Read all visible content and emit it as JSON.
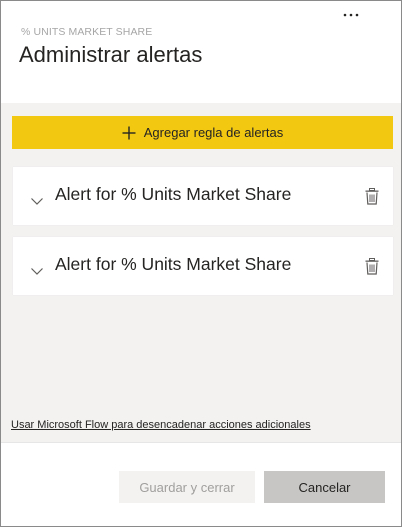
{
  "header": {
    "subtitle": "% UNITS MARKET SHARE",
    "title": "Administrar alertas",
    "more_icon": "more-horizontal-icon"
  },
  "add_rule": {
    "label": "Agregar regla de alertas",
    "icon": "plus-icon"
  },
  "rules": [
    {
      "label": "Alert for % Units Market Share",
      "expand_icon": "chevron-down-icon",
      "delete_icon": "trash-icon"
    },
    {
      "label": "Alert for % Units Market Share",
      "expand_icon": "chevron-down-icon",
      "delete_icon": "trash-icon"
    }
  ],
  "flow_link": "Usar Microsoft Flow para desencadenar acciones adicionales",
  "footer": {
    "save_label": "Guardar y cerrar",
    "cancel_label": "Cancelar"
  },
  "colors": {
    "accent": "#f2c811",
    "body_bg": "#f3f2f1",
    "cancel_bg": "#c8c6c4",
    "disabled_text": "#a19f9d"
  }
}
